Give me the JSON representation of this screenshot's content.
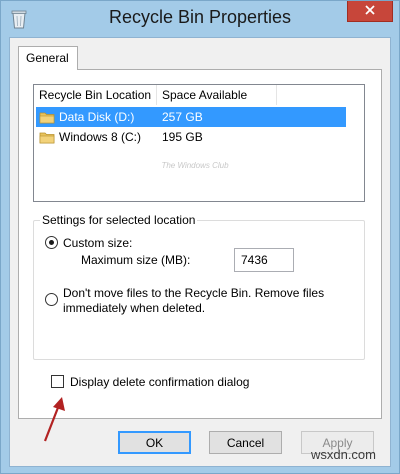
{
  "window": {
    "title": "Recycle Bin Properties",
    "close_glyph": "✕",
    "accent_color": "#c7463a"
  },
  "tabs": [
    {
      "label": "General",
      "selected": true
    }
  ],
  "list": {
    "columns": [
      "Recycle Bin Location",
      "Space Available"
    ],
    "rows": [
      {
        "name": "Data Disk (D:)",
        "space": "257 GB",
        "selected": true,
        "icon": "drive-folder-icon"
      },
      {
        "name": "Windows 8 (C:)",
        "space": "195 GB",
        "selected": false,
        "icon": "drive-folder-icon"
      }
    ],
    "watermark": "The Windows Club"
  },
  "settings": {
    "legend": "Settings for selected location",
    "custom_size_label": "Custom size:",
    "custom_size_checked": true,
    "max_size_label": "Maximum size (MB):",
    "max_size_value": "7436",
    "dont_move_label_line1": "Don't move files to the Recycle Bin. Remove files",
    "dont_move_label_line2": "immediately when deleted.",
    "dont_move_checked": false
  },
  "confirm": {
    "label": "Display delete confirmation dialog",
    "checked": false
  },
  "buttons": {
    "ok": "OK",
    "cancel": "Cancel",
    "apply": "Apply",
    "apply_enabled": false
  },
  "site_watermark": "wsxdn.com"
}
